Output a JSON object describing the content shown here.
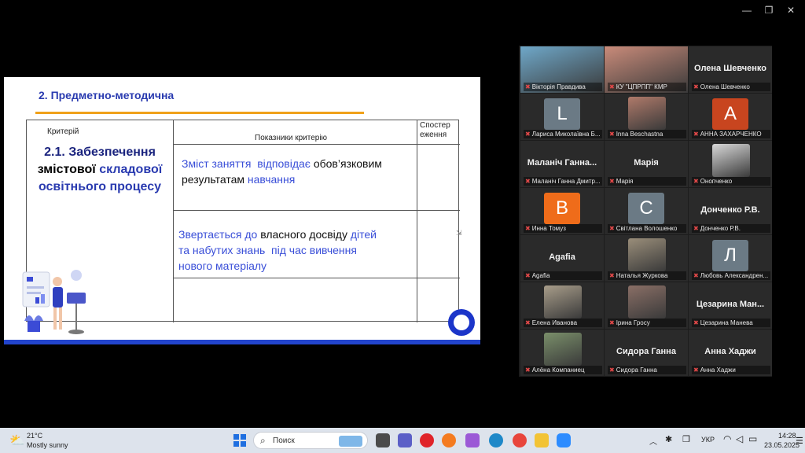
{
  "window": {
    "minimize": "—",
    "restore": "❐",
    "close": "✕"
  },
  "slide": {
    "title": "2. Предметно-методична",
    "header_criterion": "Критерій",
    "header_indicators": "Показники критерію",
    "header_observation_1": "Спостер",
    "header_observation_2": "еження",
    "criterion_part1": "2.1. Забезпечення",
    "criterion_part2a": "змістової",
    "criterion_part2b": "складової",
    "criterion_part3": "освітнього процесу",
    "row1": {
      "a": "Зміст заняття",
      "b": "відповідає",
      "c": "обов’язковим",
      "d": "результатам",
      "e": "навчання"
    },
    "row2": {
      "a": "Звертається до",
      "b": "власного досвіду",
      "c": "дітей",
      "d": "та набутих знань",
      "e": "під час вивчення",
      "f": "нового матеріалу"
    }
  },
  "gallery": [
    {
      "name": "Вікторія Правдива",
      "type": "photo",
      "color": "#6fa8c9",
      "active": true
    },
    {
      "name": "КУ \"ЦПРПП\" КМР",
      "type": "photo",
      "color": "#c98b7a",
      "active": false
    },
    {
      "name": "Олена Шевченко",
      "big": "Олена Шевченко",
      "type": "name"
    },
    {
      "name": "Лариса Миколаївна Б...",
      "type": "avatar",
      "letter": "L",
      "color": "#6b7a85"
    },
    {
      "name": "Inna Beschastna",
      "type": "photo",
      "color": "#b07a6a"
    },
    {
      "name": "АННА ЗАХАРЧЕНКО",
      "type": "avatar",
      "letter": "A",
      "color": "#c8451f"
    },
    {
      "name": "Маланіч Ганна Дмитр...",
      "big": "Маланіч Ганна...",
      "type": "name"
    },
    {
      "name": "Марія",
      "big": "Марія",
      "type": "name"
    },
    {
      "name": "Онопченко",
      "type": "photo",
      "color": "#d8d8d8"
    },
    {
      "name": "Инна Томуз",
      "type": "avatar",
      "letter": "B",
      "color": "#ef6c1a"
    },
    {
      "name": "Світлана Волошенко",
      "type": "avatar",
      "letter": "C",
      "color": "#6b7a85"
    },
    {
      "name": "Донченко Р.В.",
      "big": "Донченко Р.В.",
      "type": "name"
    },
    {
      "name": "Agafia",
      "big": "Agafia",
      "type": "name"
    },
    {
      "name": "Наталья Журкова",
      "type": "photo",
      "color": "#9a8e7a"
    },
    {
      "name": "Любовь Александрен...",
      "type": "avatar",
      "letter": "Л",
      "color": "#6b7a85"
    },
    {
      "name": "Елена Иванова",
      "type": "photo",
      "color": "#a89d8a"
    },
    {
      "name": "Ірина Гросу",
      "type": "photo",
      "color": "#8a6f66"
    },
    {
      "name": "Цезарина Манева",
      "big": "Цезарина Ман...",
      "type": "name"
    },
    {
      "name": "Алёна Компаниец",
      "type": "photo",
      "color": "#7a8f6a"
    },
    {
      "name": "Сидора Ганна",
      "big": "Сидора Ганна",
      "type": "name"
    },
    {
      "name": "Анна Хаджи",
      "big": "Анна Хаджи",
      "type": "name"
    }
  ],
  "taskbar": {
    "temp": "21°C",
    "weather": "Mostly sunny",
    "search_label": "Поиск",
    "lang": "УКР",
    "time": "14:28",
    "date": "23.05.2025"
  }
}
